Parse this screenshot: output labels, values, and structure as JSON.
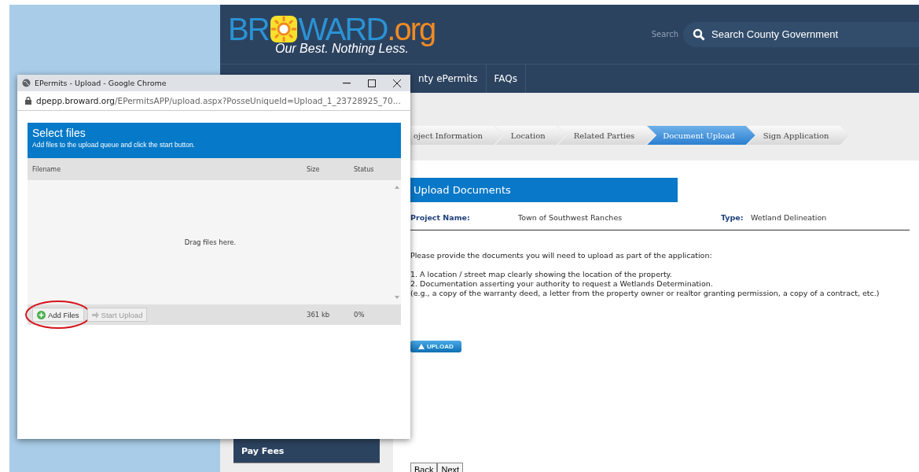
{
  "site": {
    "logo": {
      "start": "BR",
      "end": "WARD",
      "suffix": ".org",
      "tagline": "Our Best. Nothing Less."
    },
    "search": {
      "label": "Search",
      "placeholder": "Search County Government"
    },
    "nav": [
      {
        "label": "nty ePermits"
      },
      {
        "label": "FAQs"
      }
    ],
    "steps": [
      {
        "label": "oject Information",
        "selected": false
      },
      {
        "label": "Location",
        "selected": false
      },
      {
        "label": "Related Parties",
        "selected": false
      },
      {
        "label": "Document Upload",
        "selected": true
      },
      {
        "label": "Sign Application",
        "selected": false
      }
    ],
    "sidebar": {
      "items": [
        {
          "label": "Pay Fees"
        }
      ]
    },
    "main": {
      "title": "Upload Documents",
      "fields": [
        {
          "label": "Project Name:",
          "value": "Town of Southwest Ranches"
        },
        {
          "label": "Type:",
          "value": "Wetland Delineation"
        }
      ],
      "intro": "Please provide the documents you will need to upload as part of the application:",
      "items": [
        "1. A location / street map clearly showing the location of the property.",
        "2. Documentation asserting your authority to request a Wetlands Determination.",
        "(e.g., a copy of the warranty deed, a letter from the property owner or realtor granting permission, a copy of a contract, etc.)"
      ],
      "upload_button": "UPLOAD",
      "nav_buttons": [
        "Back",
        "Next"
      ]
    }
  },
  "popup": {
    "title": "EPermits - Upload - Google Chrome",
    "url": {
      "host": "dpepp.broward.org",
      "path": "/EPermitsAPP/upload.aspx?PosseUniqueId=Upload_1_23728925_70..."
    },
    "header": {
      "title": "Select files",
      "subtitle": "Add files to the upload queue and click the start button."
    },
    "columns": [
      "Filename",
      "Size",
      "Status"
    ],
    "drop_hint": "Drag files here.",
    "buttons": [
      {
        "label": "Add Files",
        "kind": "add",
        "disabled": false,
        "highlighted": true
      },
      {
        "label": "Start Upload",
        "kind": "start",
        "disabled": true,
        "highlighted": false
      }
    ],
    "total_size": "361 kb",
    "total_percent": "0%"
  }
}
